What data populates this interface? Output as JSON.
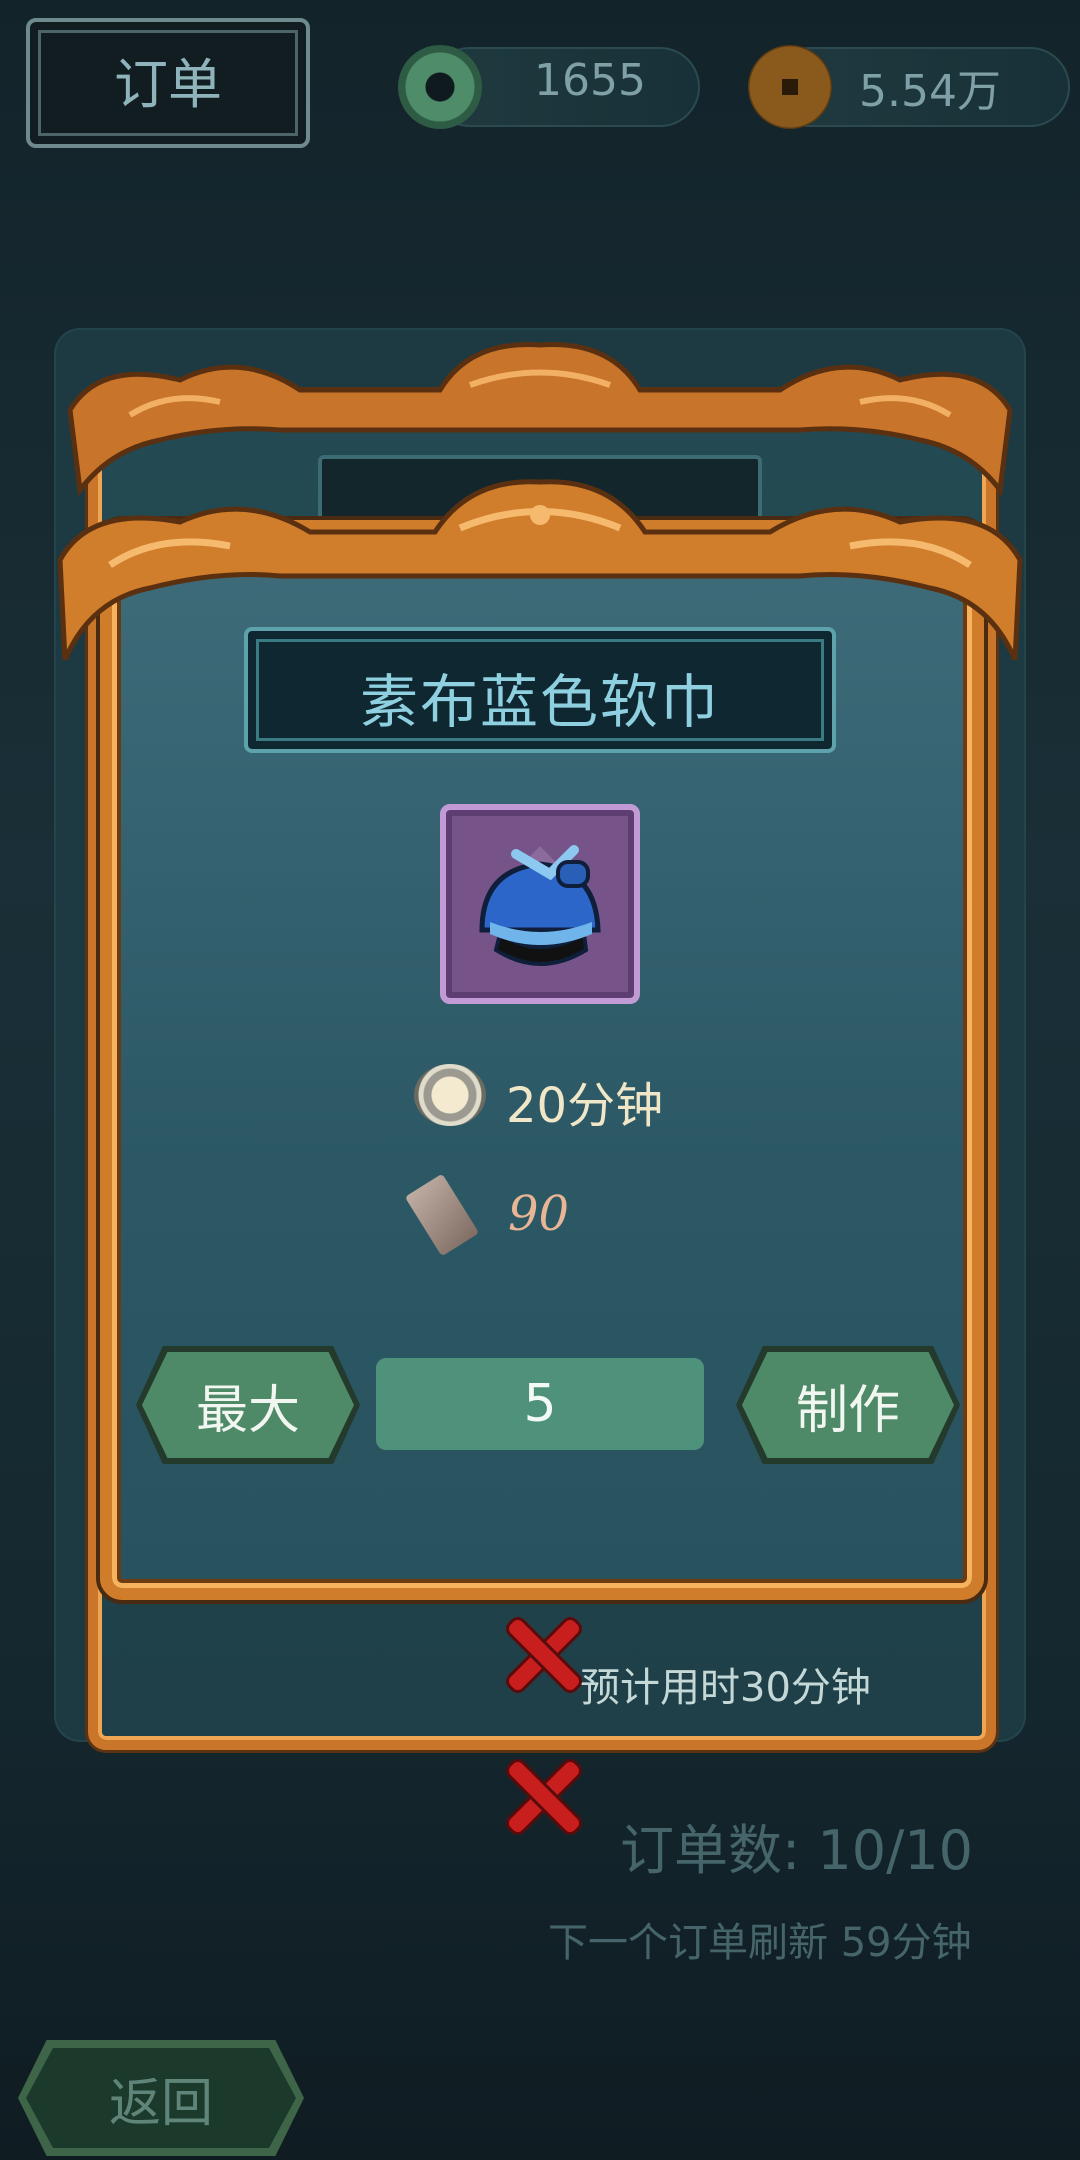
{
  "header": {
    "title": "订单",
    "jade_amount": "1655",
    "coin_amount": "5.54万"
  },
  "craft_dialog": {
    "item_name": "素布蓝色软巾",
    "time_cost": "20分钟",
    "material_cost": "90",
    "max_label": "最大",
    "quantity": "5",
    "make_label": "制作"
  },
  "back_card": {
    "estimated_time": "预计用时30分钟"
  },
  "orders": {
    "count_text": "订单数: 10/10",
    "refresh_text": "下一个订单刷新 59分钟"
  },
  "footer": {
    "back_label": "返回"
  },
  "colors": {
    "frame_gold": "#cf7c2b",
    "button_green": "#4f8a68",
    "item_slot_purple": "#76548a",
    "close_red": "#c81e1e"
  }
}
